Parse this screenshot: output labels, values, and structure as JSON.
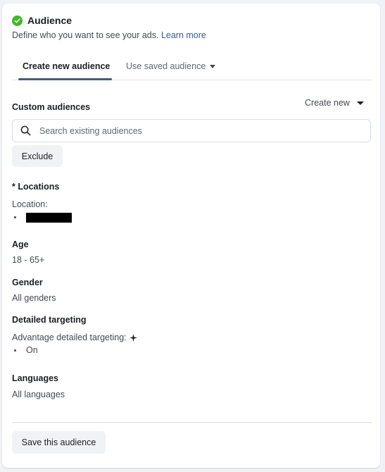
{
  "header": {
    "title": "Audience",
    "subtitle": "Define who you want to see your ads.",
    "learn_more": "Learn more"
  },
  "tabs": [
    {
      "label": "Create new audience",
      "active": true
    },
    {
      "label": "Use saved audience",
      "active": false
    }
  ],
  "custom_audiences": {
    "label": "Custom audiences",
    "create_new": "Create new",
    "search_placeholder": "Search existing audiences",
    "search_value": "",
    "exclude_label": "Exclude"
  },
  "locations": {
    "label": "* Locations",
    "sub_label": "Location:",
    "items": [
      "[redacted]"
    ]
  },
  "age": {
    "label": "Age",
    "value": "18 - 65+"
  },
  "gender": {
    "label": "Gender",
    "value": "All genders"
  },
  "detailed_targeting": {
    "label": "Detailed targeting",
    "sub_label": "Advantage detailed targeting:",
    "items": [
      "On"
    ]
  },
  "languages": {
    "label": "Languages",
    "value": "All languages"
  },
  "footer": {
    "save_label": "Save this audience"
  },
  "colors": {
    "check": "#42b72a",
    "link": "#385898",
    "tab_underline": "#4b5a78"
  }
}
